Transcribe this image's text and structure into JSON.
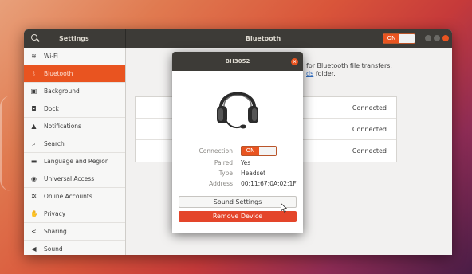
{
  "window": {
    "left_title": "Settings",
    "title": "Bluetooth",
    "power_toggle": "ON"
  },
  "sidebar": {
    "items": [
      {
        "label": "Wi-Fi",
        "icon": "wifi-icon"
      },
      {
        "label": "Bluetooth",
        "icon": "bluetooth-icon",
        "active": true
      },
      {
        "label": "Background",
        "icon": "background-icon"
      },
      {
        "label": "Dock",
        "icon": "dock-icon"
      },
      {
        "label": "Notifications",
        "icon": "bell-icon"
      },
      {
        "label": "Search",
        "icon": "search-icon"
      },
      {
        "label": "Language and Region",
        "icon": "keyboard-icon"
      },
      {
        "label": "Universal Access",
        "icon": "accessibility-icon"
      },
      {
        "label": "Online Accounts",
        "icon": "accounts-icon"
      },
      {
        "label": "Privacy",
        "icon": "hand-icon"
      },
      {
        "label": "Sharing",
        "icon": "share-icon"
      },
      {
        "label": "Sound",
        "icon": "speaker-icon"
      }
    ]
  },
  "content": {
    "text_line1": "for Bluetooth file transfers.",
    "text_link": "ds",
    "text_line2_rest": " folder.",
    "devices": [
      {
        "status": "Connected"
      },
      {
        "status": "Connected"
      },
      {
        "status": "Connected"
      }
    ]
  },
  "dialog": {
    "title": "BH3052",
    "close": "×",
    "connection_label": "Connection",
    "connection_toggle": "ON",
    "paired_label": "Paired",
    "paired_value": "Yes",
    "type_label": "Type",
    "type_value": "Headset",
    "address_label": "Address",
    "address_value": "00:11:67:0A:02:1F",
    "sound_settings_button": "Sound Settings",
    "remove_button": "Remove Device"
  },
  "colors": {
    "accent": "#e95420",
    "titlebar": "#3d3b37"
  }
}
